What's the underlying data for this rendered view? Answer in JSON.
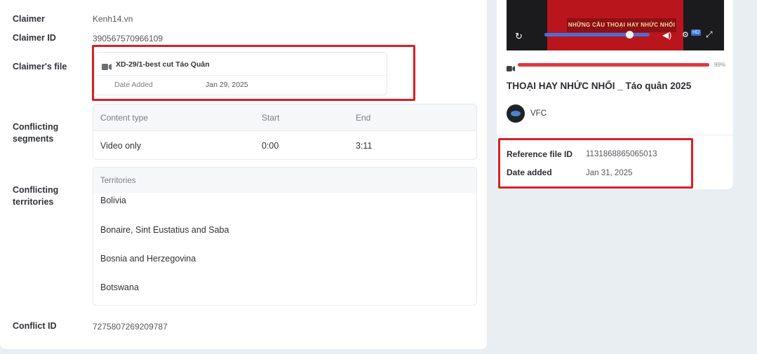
{
  "claim": {
    "claimer_label": "Claimer",
    "claimer_value": "Kenh14.vn",
    "claimer_id_label": "Claimer ID",
    "claimer_id_value": "390567570966109",
    "claimers_file_label": "Claimer's file",
    "file": {
      "name": "XD-29/1-best cut Táo Quân",
      "date_added_label": "Date Added",
      "date_added_value": "Jan 29, 2025"
    },
    "conflicting_segments_label": "Conflicting segments",
    "segments": {
      "headers": [
        "Content type",
        "Start",
        "End"
      ],
      "rows": [
        [
          "Video only",
          "0:00",
          "3:11"
        ]
      ]
    },
    "conflicting_territories_label": "Conflicting territories",
    "territories": {
      "header": "Territories",
      "items": [
        "Bolivia",
        "Bonaire, Sint Eustatius and Saba",
        "Bosnia and Herzegovina",
        "Botswana"
      ]
    },
    "conflict_id_label": "Conflict ID",
    "conflict_id_value": "7275807269209787"
  },
  "reference": {
    "video": {
      "banner_text": "NHỮNG CÂU THOẠI HAY NHỨC NHỐI",
      "hd_badge": "HD",
      "icons": [
        "replay-icon",
        "volume-icon",
        "settings-icon",
        "fullscreen-icon"
      ]
    },
    "match_percent": "99%",
    "match_fraction": 0.99,
    "title": "THOẠI HAY NHỨC NHỐI _ Táo quân 2025",
    "channel": "VFC",
    "reference_file_id_label": "Reference file ID",
    "reference_file_id_value": "1131868865065013",
    "date_added_label": "Date added",
    "date_added_value": "Jan 31, 2025"
  },
  "colors": {
    "highlight_red": "#d91f26",
    "progress_blue": "#4a6fd8",
    "match_red": "#e0383e"
  }
}
